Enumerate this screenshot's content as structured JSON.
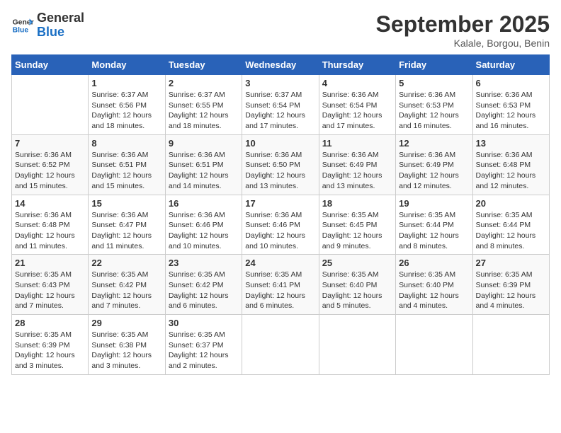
{
  "logo": {
    "line1": "General",
    "line2": "Blue"
  },
  "title": "September 2025",
  "location": "Kalale, Borgou, Benin",
  "days_header": [
    "Sunday",
    "Monday",
    "Tuesday",
    "Wednesday",
    "Thursday",
    "Friday",
    "Saturday"
  ],
  "weeks": [
    [
      {
        "day": "",
        "info": ""
      },
      {
        "day": "1",
        "info": "Sunrise: 6:37 AM\nSunset: 6:56 PM\nDaylight: 12 hours\nand 18 minutes."
      },
      {
        "day": "2",
        "info": "Sunrise: 6:37 AM\nSunset: 6:55 PM\nDaylight: 12 hours\nand 18 minutes."
      },
      {
        "day": "3",
        "info": "Sunrise: 6:37 AM\nSunset: 6:54 PM\nDaylight: 12 hours\nand 17 minutes."
      },
      {
        "day": "4",
        "info": "Sunrise: 6:36 AM\nSunset: 6:54 PM\nDaylight: 12 hours\nand 17 minutes."
      },
      {
        "day": "5",
        "info": "Sunrise: 6:36 AM\nSunset: 6:53 PM\nDaylight: 12 hours\nand 16 minutes."
      },
      {
        "day": "6",
        "info": "Sunrise: 6:36 AM\nSunset: 6:53 PM\nDaylight: 12 hours\nand 16 minutes."
      }
    ],
    [
      {
        "day": "7",
        "info": "Sunrise: 6:36 AM\nSunset: 6:52 PM\nDaylight: 12 hours\nand 15 minutes."
      },
      {
        "day": "8",
        "info": "Sunrise: 6:36 AM\nSunset: 6:51 PM\nDaylight: 12 hours\nand 15 minutes."
      },
      {
        "day": "9",
        "info": "Sunrise: 6:36 AM\nSunset: 6:51 PM\nDaylight: 12 hours\nand 14 minutes."
      },
      {
        "day": "10",
        "info": "Sunrise: 6:36 AM\nSunset: 6:50 PM\nDaylight: 12 hours\nand 13 minutes."
      },
      {
        "day": "11",
        "info": "Sunrise: 6:36 AM\nSunset: 6:49 PM\nDaylight: 12 hours\nand 13 minutes."
      },
      {
        "day": "12",
        "info": "Sunrise: 6:36 AM\nSunset: 6:49 PM\nDaylight: 12 hours\nand 12 minutes."
      },
      {
        "day": "13",
        "info": "Sunrise: 6:36 AM\nSunset: 6:48 PM\nDaylight: 12 hours\nand 12 minutes."
      }
    ],
    [
      {
        "day": "14",
        "info": "Sunrise: 6:36 AM\nSunset: 6:48 PM\nDaylight: 12 hours\nand 11 minutes."
      },
      {
        "day": "15",
        "info": "Sunrise: 6:36 AM\nSunset: 6:47 PM\nDaylight: 12 hours\nand 11 minutes."
      },
      {
        "day": "16",
        "info": "Sunrise: 6:36 AM\nSunset: 6:46 PM\nDaylight: 12 hours\nand 10 minutes."
      },
      {
        "day": "17",
        "info": "Sunrise: 6:36 AM\nSunset: 6:46 PM\nDaylight: 12 hours\nand 10 minutes."
      },
      {
        "day": "18",
        "info": "Sunrise: 6:35 AM\nSunset: 6:45 PM\nDaylight: 12 hours\nand 9 minutes."
      },
      {
        "day": "19",
        "info": "Sunrise: 6:35 AM\nSunset: 6:44 PM\nDaylight: 12 hours\nand 8 minutes."
      },
      {
        "day": "20",
        "info": "Sunrise: 6:35 AM\nSunset: 6:44 PM\nDaylight: 12 hours\nand 8 minutes."
      }
    ],
    [
      {
        "day": "21",
        "info": "Sunrise: 6:35 AM\nSunset: 6:43 PM\nDaylight: 12 hours\nand 7 minutes."
      },
      {
        "day": "22",
        "info": "Sunrise: 6:35 AM\nSunset: 6:42 PM\nDaylight: 12 hours\nand 7 minutes."
      },
      {
        "day": "23",
        "info": "Sunrise: 6:35 AM\nSunset: 6:42 PM\nDaylight: 12 hours\nand 6 minutes."
      },
      {
        "day": "24",
        "info": "Sunrise: 6:35 AM\nSunset: 6:41 PM\nDaylight: 12 hours\nand 6 minutes."
      },
      {
        "day": "25",
        "info": "Sunrise: 6:35 AM\nSunset: 6:40 PM\nDaylight: 12 hours\nand 5 minutes."
      },
      {
        "day": "26",
        "info": "Sunrise: 6:35 AM\nSunset: 6:40 PM\nDaylight: 12 hours\nand 4 minutes."
      },
      {
        "day": "27",
        "info": "Sunrise: 6:35 AM\nSunset: 6:39 PM\nDaylight: 12 hours\nand 4 minutes."
      }
    ],
    [
      {
        "day": "28",
        "info": "Sunrise: 6:35 AM\nSunset: 6:39 PM\nDaylight: 12 hours\nand 3 minutes."
      },
      {
        "day": "29",
        "info": "Sunrise: 6:35 AM\nSunset: 6:38 PM\nDaylight: 12 hours\nand 3 minutes."
      },
      {
        "day": "30",
        "info": "Sunrise: 6:35 AM\nSunset: 6:37 PM\nDaylight: 12 hours\nand 2 minutes."
      },
      {
        "day": "",
        "info": ""
      },
      {
        "day": "",
        "info": ""
      },
      {
        "day": "",
        "info": ""
      },
      {
        "day": "",
        "info": ""
      }
    ]
  ]
}
